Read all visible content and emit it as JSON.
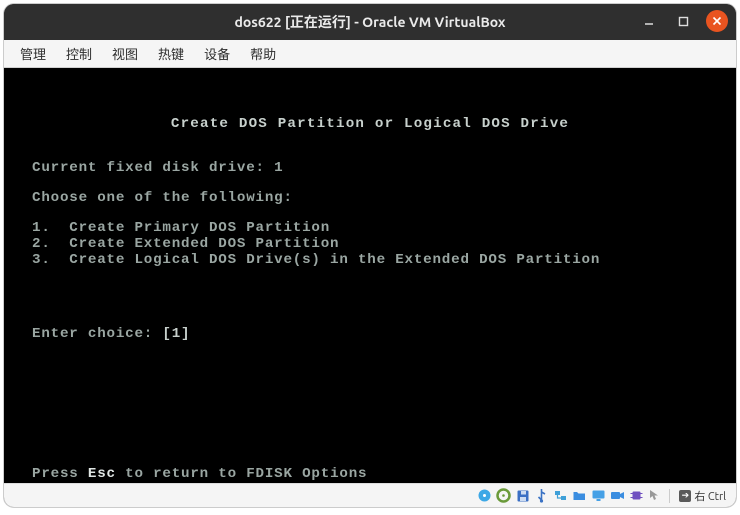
{
  "window": {
    "title": "dos622 [正在运行] - Oracle VM VirtualBox"
  },
  "menu": {
    "items": [
      "管理",
      "控制",
      "视图",
      "热键",
      "设备",
      "帮助"
    ]
  },
  "dos": {
    "title": "Create DOS Partition or Logical DOS Drive",
    "current_disk_label": "Current fixed disk drive: ",
    "current_disk_value": "1",
    "choose_label": "Choose one of the following:",
    "options": [
      "1.  Create Primary DOS Partition",
      "2.  Create Extended DOS Partition",
      "3.  Create Logical DOS Drive(s) in the Extended DOS Partition"
    ],
    "enter_choice_label": "Enter choice: ",
    "enter_choice_value": "[1]",
    "footer_pre": "Press ",
    "footer_key": "Esc",
    "footer_post": " to return to FDISK Options"
  },
  "statusbar": {
    "host_key": "右 Ctrl"
  },
  "icons": {
    "hdd": "hard-disk-icon",
    "cd": "optical-disk-icon",
    "floppy": "floppy-icon",
    "usb": "usb-icon",
    "net": "network-icon",
    "shared": "shared-folder-icon",
    "display": "display-icon",
    "rec": "recording-icon",
    "cpu": "processor-icon",
    "mouse": "mouse-integration-icon"
  }
}
